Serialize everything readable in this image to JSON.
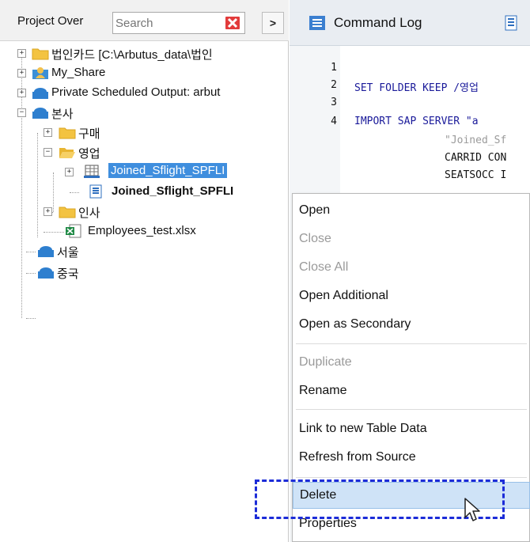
{
  "project_panel": {
    "title": "Project Over",
    "search_placeholder": "Search",
    "clear_icon": "red-x-icon",
    "nav_glyph": ">",
    "tree": [
      {
        "label": "법인카드 [C:\\Arbutus_data\\법인",
        "icon": "folder-icon",
        "expander": "+"
      },
      {
        "label": "My_Share",
        "icon": "user-folder-icon",
        "expander": "+"
      },
      {
        "label": "Private Scheduled Output:  arbut",
        "icon": "cloud-folder-icon",
        "expander": "+"
      },
      {
        "label": "본사",
        "icon": "cloud-folder-icon",
        "expander": "−"
      },
      {
        "label": "구매",
        "icon": "folder-icon",
        "expander": "+"
      },
      {
        "label": "영업",
        "icon": "open-folder-icon",
        "expander": "−"
      },
      {
        "label": "Joined_Sflight_SPFLI",
        "icon": "table-icon",
        "expander": "+"
      },
      {
        "label": "Joined_Sflight_SPFLI",
        "icon": "script-icon"
      },
      {
        "label": "인사",
        "icon": "folder-icon",
        "expander": "+"
      },
      {
        "label": "Employees_test.xlsx",
        "icon": "excel-icon"
      },
      {
        "label": "서울",
        "icon": "cloud-folder-icon"
      },
      {
        "label": "중국",
        "icon": "cloud-folder-icon"
      }
    ]
  },
  "editor": {
    "tabs": [
      {
        "label": "Command Log",
        "icon": "log-icon"
      },
      {
        "label": "",
        "icon": "script-icon"
      }
    ],
    "lines": [
      {
        "n": "1",
        "code": ""
      },
      {
        "n": "2",
        "code": "SET FOLDER KEEP /영업"
      },
      {
        "n": "3",
        "code": ""
      },
      {
        "n": "4",
        "code": "IMPORT SAP SERVER \"a"
      },
      {
        "n": "",
        "code": "\"Joined_Sf"
      },
      {
        "n": "",
        "code": "CARRID CON"
      },
      {
        "n": "",
        "code": "SEATSOCC I"
      }
    ]
  },
  "context_menu": {
    "items": [
      {
        "label": "Open",
        "enabled": true
      },
      {
        "label": "Close",
        "enabled": false
      },
      {
        "label": "Close All",
        "enabled": false
      },
      {
        "label": "Open Additional",
        "enabled": true
      },
      {
        "label": "Open as Secondary",
        "enabled": true
      },
      {
        "label": "Duplicate",
        "enabled": false
      },
      {
        "label": "Rename",
        "enabled": true
      },
      {
        "label": "Link to new Table Data",
        "enabled": true
      },
      {
        "label": "Refresh from Source",
        "enabled": true
      },
      {
        "label": "Delete",
        "enabled": true,
        "highlighted": true
      },
      {
        "label": "Properties",
        "enabled": true
      }
    ]
  },
  "colors": {
    "selection": "#3f8ede",
    "menu_hover": "#cfe3f7",
    "annotation_box": "#1c2cd8",
    "keyword": "#1a1a9a"
  }
}
